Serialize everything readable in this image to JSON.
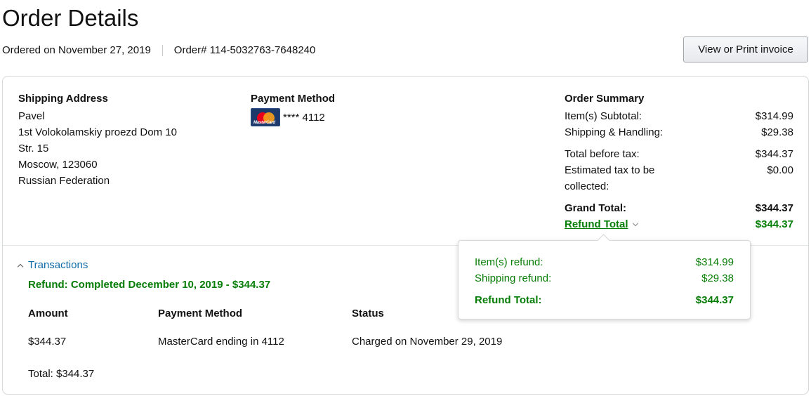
{
  "header": {
    "title": "Order Details",
    "ordered_on": "Ordered on November 27, 2019",
    "order_number": "Order# 114-5032763-7648240",
    "invoice_button": "View or Print invoice"
  },
  "shipping": {
    "title": "Shipping Address",
    "lines": [
      "Pavel",
      "1st Volokolamskiy proezd Dom 10",
      "Str. 15",
      "Moscow, 123060",
      "Russian Federation"
    ]
  },
  "payment": {
    "title": "Payment Method",
    "card_icon": "mastercard-icon",
    "card_logo_text": "MasterCard",
    "card_masked": "**** 4112"
  },
  "summary": {
    "title": "Order Summary",
    "rows": [
      {
        "label": "Item(s) Subtotal:",
        "value": "$314.99"
      },
      {
        "label": "Shipping & Handling:",
        "value": "$29.38"
      },
      {
        "label": "Total before tax:",
        "value": "$344.37"
      },
      {
        "label": "Estimated tax to be collected:",
        "value": "$0.00"
      }
    ],
    "grand_total_label": "Grand Total:",
    "grand_total_value": "$344.37",
    "refund_total_label": "Refund Total",
    "refund_total_value": "$344.37"
  },
  "transactions": {
    "toggle_label": "Transactions",
    "status": "Refund: Completed December 10, 2019 - $344.37",
    "headers": [
      "Amount",
      "Payment Method",
      "Status"
    ],
    "row": [
      "$344.37",
      "MasterCard ending in 4112",
      "Charged on November 29, 2019"
    ],
    "total": "Total: $344.37"
  },
  "refund_popover": {
    "rows": [
      {
        "label": "Item(s) refund:",
        "value": "$314.99"
      },
      {
        "label": "Shipping refund:",
        "value": "$29.38"
      }
    ],
    "total_label": "Refund Total:",
    "total_value": "$344.37"
  },
  "colors": {
    "green": "#067d06",
    "link_blue": "#0f6ba8",
    "border": "#d5d9d9"
  }
}
